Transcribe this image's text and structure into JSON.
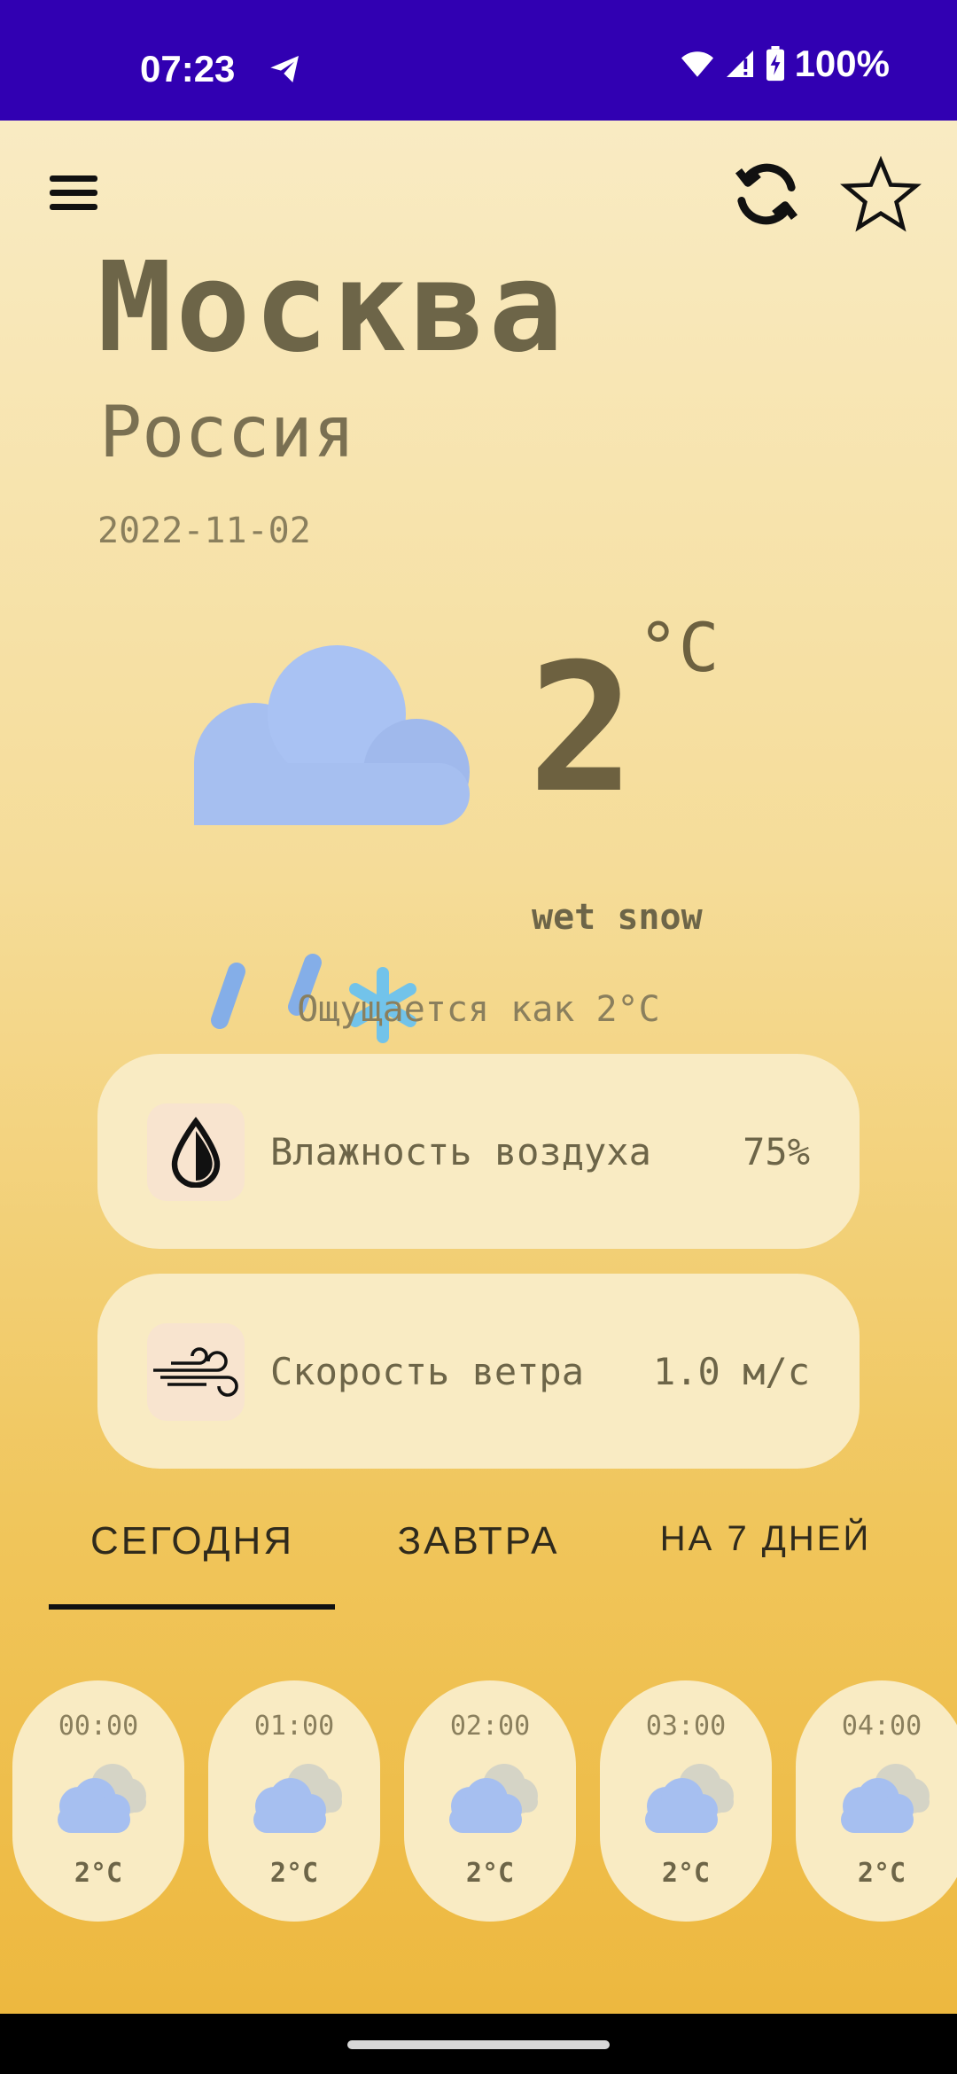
{
  "status_bar": {
    "time": "07:23",
    "battery": "100%",
    "icons": [
      "telegram-icon",
      "wifi-icon",
      "signal-icon",
      "battery-charging-icon"
    ]
  },
  "header": {
    "menu_icon": "menu-icon",
    "refresh_icon": "refresh-icon",
    "favorite_icon": "star-outline-icon"
  },
  "location": {
    "city": "Москва",
    "country": "Россия",
    "date": "2022-11-02"
  },
  "current": {
    "temperature": "2",
    "unit": "°C",
    "condition": "wet snow",
    "feels_like": "Ощущается как 2°C",
    "icon": "cloud-rain-snow-icon"
  },
  "details": {
    "humidity": {
      "label": "Влажность воздуха",
      "value": "75%",
      "icon": "water-drop-icon"
    },
    "wind": {
      "label": "Скорость ветра",
      "value": "1.0 м/с",
      "icon": "wind-icon"
    }
  },
  "tabs": [
    {
      "label": "СЕГОДНЯ",
      "selected": true
    },
    {
      "label": "ЗАВТРА",
      "selected": false
    },
    {
      "label": "НА 7 ДНЕЙ",
      "selected": false
    }
  ],
  "hourly": [
    {
      "time": "00:00",
      "temp": "2°C",
      "icon": "cloudy-icon"
    },
    {
      "time": "01:00",
      "temp": "2°C",
      "icon": "cloudy-icon"
    },
    {
      "time": "02:00",
      "temp": "2°C",
      "icon": "cloudy-icon"
    },
    {
      "time": "03:00",
      "temp": "2°C",
      "icon": "cloudy-icon"
    },
    {
      "time": "04:00",
      "temp": "2°C",
      "icon": "cloudy-icon"
    }
  ],
  "colors": {
    "status_bar": "#3100b2",
    "card": "#f9ebc3",
    "text_primary": "#6d6548",
    "cloud_blue": "#a6bff0",
    "snow": "#7dc8ee"
  }
}
